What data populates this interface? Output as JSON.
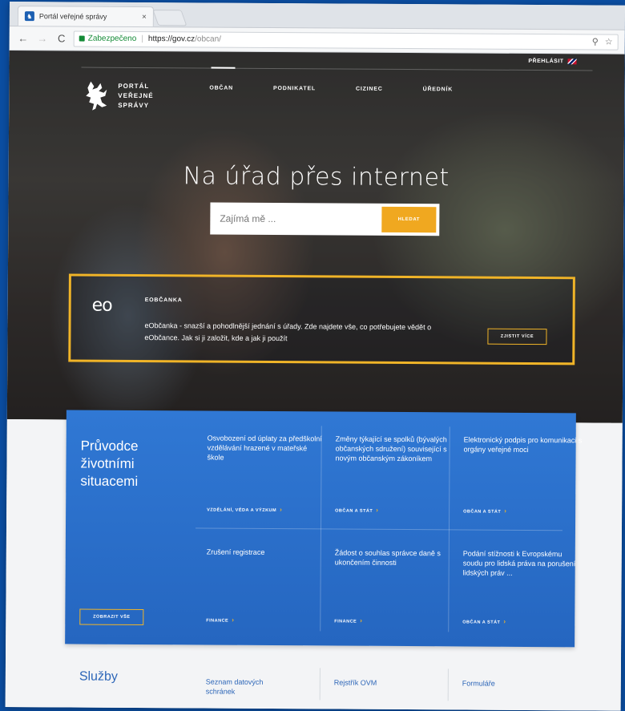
{
  "browser": {
    "tab_title": "Portál veřejné správy",
    "tab_close": "×",
    "security_label": "Zabezpečeno",
    "url_scheme_host": "https://gov.cz",
    "url_path": "/obcan/"
  },
  "header": {
    "lang_switch": "PŘEHLÁSIT",
    "logo_lines": [
      "PORTÁL",
      "VEŘEJNÉ",
      "SPRÁVY"
    ],
    "nav": [
      "OBČAN",
      "PODNIKATEL",
      "CIZINEC",
      "ÚŘEDNÍK"
    ]
  },
  "hero": {
    "title": "Na úřad přes internet",
    "search_placeholder": "Zajímá mě ...",
    "search_button": "HLEDAT"
  },
  "eop": {
    "logo": "eo",
    "title": "EOBČANKA",
    "text": "eObčanka - snazší a pohodlnější jednání s úřady. Zde najdete vše, co potřebujete vědět o eObčance. Jak si ji založit, kde a jak ji použít",
    "button": "ZJISTIT VÍCE"
  },
  "situations": {
    "title": "Průvodce životními situacemi",
    "show_all": "ZOBRAZIT VŠE",
    "items": [
      {
        "text": "Osvobození od úplaty za předškolní vzdělávání hrazené v mateřské škole",
        "tag": "VZDĚLÁNÍ, VĚDA A VÝZKUM"
      },
      {
        "text": "Změny týkající se spolků (bývalých občanských sdružení) související s novým občanským zákoníkem",
        "tag": "OBČAN A STÁT"
      },
      {
        "text": "Elektronický podpis pro komunikaci s orgány veřejné moci",
        "tag": "OBČAN A STÁT"
      },
      {
        "text": "Zrušení registrace",
        "tag": "FINANCE"
      },
      {
        "text": "Žádost o souhlas správce daně s ukončením činnosti",
        "tag": "FINANCE"
      },
      {
        "text": "Podání stížnosti k Evropskému soudu pro lidská práva na porušení lidských práv ...",
        "tag": "OBČAN A STÁT"
      }
    ]
  },
  "services": {
    "title": "Služby",
    "items": [
      "Seznam datových schránek",
      "Rejstřík OVM",
      "Formuláře"
    ]
  },
  "colors": {
    "accent": "#f0a820",
    "brand_blue": "#2a6fc9",
    "page_bg": "#0b4ea2"
  }
}
